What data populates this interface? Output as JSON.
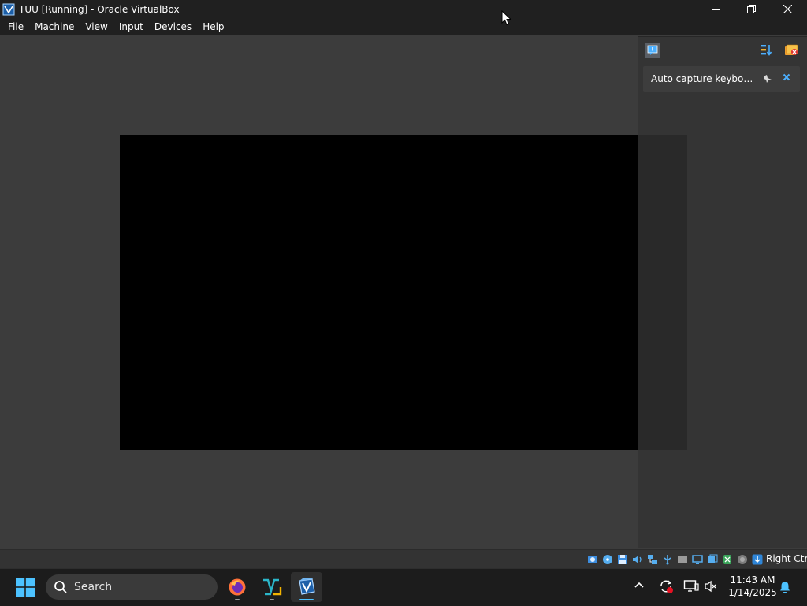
{
  "window": {
    "title": "TUU [Running] - Oracle VirtualBox",
    "controls": {
      "minimize": "minimize",
      "maximize": "restore",
      "close": "close"
    }
  },
  "menu": [
    "File",
    "Machine",
    "View",
    "Input",
    "Devices",
    "Help"
  ],
  "notification_center": {
    "items": [
      {
        "text": "Auto capture keyboard ..."
      }
    ]
  },
  "statusbar": {
    "icons": [
      "hard-disk-icon",
      "optical-drive-icon",
      "floppy-icon",
      "audio-icon",
      "network-icon",
      "usb-icon",
      "shared-folders-icon",
      "display-icon",
      "recording-icon",
      "mouse-integration-icon",
      "cpu-icon",
      "keyboard-icon"
    ],
    "host_key": "Right Ctrl"
  },
  "taskbar": {
    "search_placeholder": "Search",
    "apps": [
      "Firefox",
      "Visual Studio Code",
      "Oracle VirtualBox"
    ],
    "time": "11:43 AM",
    "date": "1/14/2025"
  },
  "colors": {
    "titlebar": "#202020",
    "vm_background": "#3c3c3c",
    "guest_screen": "#000000",
    "accent": "#4cc2ff"
  }
}
